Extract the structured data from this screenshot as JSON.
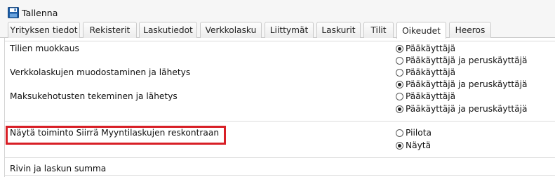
{
  "toolbar": {
    "save_label": "Tallenna",
    "save_icon": "save-disk-icon"
  },
  "tabs": [
    {
      "label": "Yrityksen tiedot"
    },
    {
      "label": "Rekisterit"
    },
    {
      "label": "Laskutiedot"
    },
    {
      "label": "Verkkolasku"
    },
    {
      "label": "Liittymät"
    },
    {
      "label": "Laskurit"
    },
    {
      "label": "Tilit"
    },
    {
      "label": "Oikeudet",
      "active": true
    },
    {
      "label": "Heeros"
    }
  ],
  "settings": [
    {
      "label": "Tilien muokkaus",
      "options": [
        {
          "label": "Pääkäyttäjä",
          "selected": true
        },
        {
          "label": "Pääkäyttäjä ja peruskäyttäjä",
          "selected": false
        }
      ]
    },
    {
      "label": "Verkkolaskujen muodostaminen ja lähetys",
      "options": [
        {
          "label": "Pääkäyttäjä",
          "selected": false
        },
        {
          "label": "Pääkäyttäjä ja peruskäyttäjä",
          "selected": true
        }
      ]
    },
    {
      "label": "Maksukehotusten tekeminen ja lähetys",
      "options": [
        {
          "label": "Pääkäyttäjä",
          "selected": false
        },
        {
          "label": "Pääkäyttäjä ja peruskäyttäjä",
          "selected": true
        }
      ]
    },
    {
      "label": "Näytä toiminto Siirrä Myyntilaskujen reskontraan",
      "options": [
        {
          "label": "Piilota",
          "selected": false
        },
        {
          "label": "Näytä",
          "selected": true
        }
      ]
    },
    {
      "label": "Rivin ja laskun summa",
      "options": []
    }
  ],
  "colors": {
    "highlight_border": "#d81f26",
    "save_icon_blue": "#1f5fa8"
  }
}
